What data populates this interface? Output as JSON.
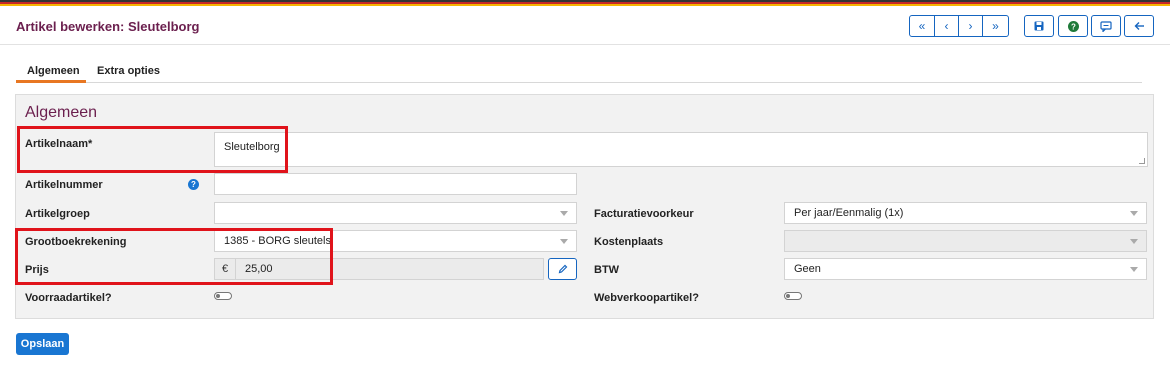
{
  "header": {
    "title": "Artikel bewerken: Sleutelborg"
  },
  "toolbar": {
    "nav": [
      {
        "icon": "chevrons-left-icon",
        "glyph": "«"
      },
      {
        "icon": "chevron-left-icon",
        "glyph": "‹"
      },
      {
        "icon": "chevron-right-icon",
        "glyph": "›"
      },
      {
        "icon": "chevrons-right-icon",
        "glyph": "»"
      }
    ],
    "save_icon": "floppy-disk-icon",
    "help_icon": "question-circle-icon",
    "comment_icon": "comment-icon",
    "back_icon": "arrow-left-icon"
  },
  "tabs": [
    {
      "label": "Algemeen",
      "active": true
    },
    {
      "label": "Extra opties",
      "active": false
    }
  ],
  "panel": {
    "title": "Algemeen"
  },
  "form": {
    "artikelnaam": {
      "label": "Artikelnaam*",
      "value": "Sleutelborg"
    },
    "artikelnummer": {
      "label": "Artikelnummer",
      "value": "",
      "help": "?"
    },
    "artikelgroep": {
      "label": "Artikelgroep",
      "value": ""
    },
    "grootboekrekening": {
      "label": "Grootboekrekening",
      "value": "1385 - BORG sleutels"
    },
    "prijs": {
      "label": "Prijs",
      "currency": "€",
      "value": "25,00"
    },
    "voorraadartikel": {
      "label": "Voorraadartikel?",
      "on": false
    },
    "facturatievoorkeur": {
      "label": "Facturatievoorkeur",
      "value": "Per jaar/Eenmalig (1x)"
    },
    "kostenplaats": {
      "label": "Kostenplaats",
      "value": ""
    },
    "btw": {
      "label": "BTW",
      "value": "Geen"
    },
    "webverkoopartikel": {
      "label": "Webverkoopartikel?",
      "on": false
    }
  },
  "footer": {
    "save_label": "Opslaan"
  },
  "colors": {
    "accent": "#1976d2",
    "title": "#6b1f4e",
    "tab_active": "#e87722",
    "highlight": "#e0131b"
  }
}
